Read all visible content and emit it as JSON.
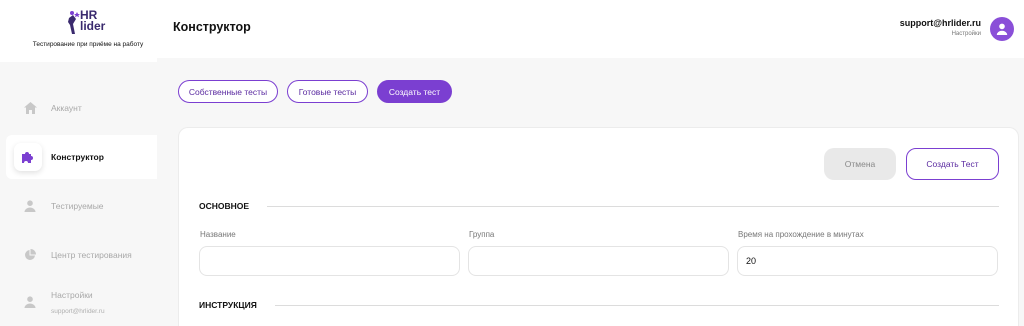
{
  "brand": {
    "logo_line1": "HR",
    "logo_line2": "lider",
    "tagline": "Тестирование при приёме на работу",
    "accent": "#7b3fd1"
  },
  "sidebar": {
    "items": [
      {
        "label": "Аккаунт",
        "icon": "home-icon"
      },
      {
        "label": "Конструктор",
        "icon": "puzzle-icon",
        "active": true
      },
      {
        "label": "Тестируемые",
        "icon": "person-icon"
      },
      {
        "label": "Центр тестирования",
        "icon": "pie-chart-icon"
      },
      {
        "label": "Настройки",
        "sub": "support@hrlider.ru",
        "icon": "user-settings-icon"
      }
    ]
  },
  "header": {
    "title": "Конструктор",
    "email": "support@hrlider.ru",
    "settings_label": "Настройки"
  },
  "tabs": [
    {
      "label": "Собственные тесты"
    },
    {
      "label": "Готовые тесты"
    },
    {
      "label": "Создать тест",
      "active": true
    }
  ],
  "form": {
    "cancel_label": "Отмена",
    "create_label": "Создать Тест",
    "section_basic": "ОСНОВНОЕ",
    "section_instruction": "ИНСТРУКЦИЯ",
    "fields": [
      {
        "label": "Название",
        "value": ""
      },
      {
        "label": "Группа",
        "value": ""
      },
      {
        "label": "Время на прохождение в минутах",
        "value": "20"
      }
    ]
  }
}
